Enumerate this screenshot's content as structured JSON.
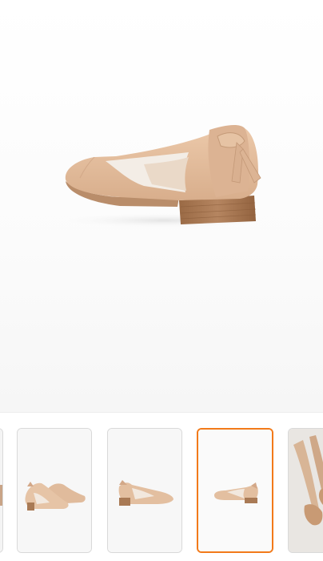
{
  "product": {
    "main_image": {
      "subject": "nude-flat-shoe-side-view"
    },
    "gallery": {
      "active_index": 3,
      "thumbnails": [
        {
          "view": "partial-previous"
        },
        {
          "view": "pair-angle"
        },
        {
          "view": "single-side"
        },
        {
          "view": "single-side-small"
        },
        {
          "view": "worn-on-foot"
        }
      ]
    }
  },
  "colors": {
    "shoe": "#e3bfa0",
    "heel": "#a97a55",
    "active_border": "#f27a1a"
  }
}
